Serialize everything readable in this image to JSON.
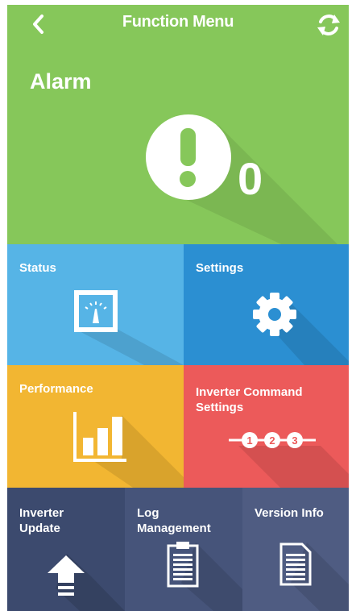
{
  "header": {
    "title": "Function Menu",
    "back_icon": "chevron-left-icon",
    "refresh_icon": "refresh-icon",
    "color": "#86c75a"
  },
  "alarm": {
    "label": "Alarm",
    "count": "0",
    "icon": "exclamation-circle-icon",
    "color": "#86c75a"
  },
  "tiles": {
    "status": {
      "label": "Status",
      "icon": "gauge-meter-icon",
      "color": "#56b4e6"
    },
    "settings": {
      "label": "Settings",
      "icon": "gear-icon",
      "color": "#2b8fd2"
    },
    "performance": {
      "label": "Performance",
      "icon": "bar-chart-icon",
      "color": "#f2b632"
    },
    "inverter_command": {
      "label": "Inverter Command\nSettings",
      "icon": "steps-123-icon",
      "step_labels": [
        "1",
        "2",
        "3"
      ],
      "color": "#ec5a5a"
    },
    "inverter_update": {
      "label": "Inverter\nUpdate",
      "icon": "upload-arrow-icon",
      "color": "#3c4a6e"
    },
    "log_management": {
      "label": "Log\nManagement",
      "icon": "clipboard-icon",
      "color": "#46547a"
    },
    "version_info": {
      "label": "Version Info",
      "icon": "document-icon",
      "color": "#4f5c82"
    }
  }
}
